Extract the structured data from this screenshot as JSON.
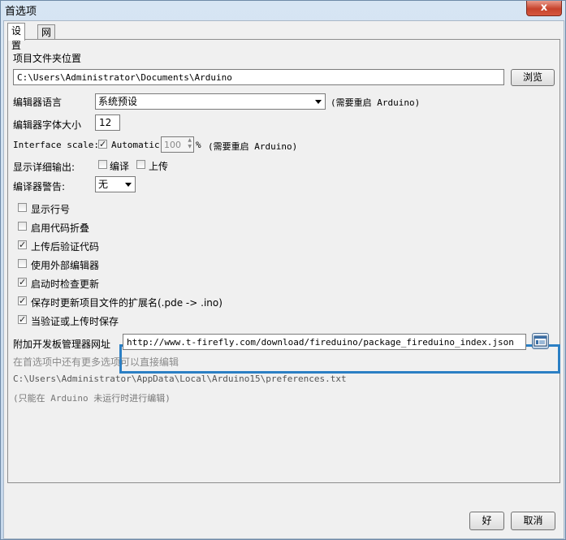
{
  "window": {
    "title": "首选项",
    "close_label": "x"
  },
  "tabs": [
    {
      "label": "设置"
    },
    {
      "label": "网络"
    }
  ],
  "sketchbook": {
    "label": "项目文件夹位置",
    "path": "C:\\Users\\Administrator\\Documents\\Arduino",
    "browse_label": "浏览"
  },
  "editor_language": {
    "label": "编辑器语言",
    "value": "系统预设",
    "note": "(需要重启 Arduino)"
  },
  "font_size": {
    "label": "编辑器字体大小",
    "value": "12"
  },
  "interface_scale": {
    "label": "Interface scale:",
    "automatic_label": "Automatic",
    "automatic_checked": true,
    "value": "100",
    "unit": "%",
    "note": "(需要重启 Arduino)"
  },
  "verbose": {
    "label": "显示详细输出:",
    "compile_label": "编译",
    "compile_checked": false,
    "upload_label": "上传",
    "upload_checked": false
  },
  "compiler_warnings": {
    "label": "编译器警告:",
    "value": "无"
  },
  "options": [
    {
      "label": "显示行号",
      "checked": false
    },
    {
      "label": "启用代码折叠",
      "checked": false
    },
    {
      "label": "上传后验证代码",
      "checked": true
    },
    {
      "label": "使用外部编辑器",
      "checked": false
    },
    {
      "label": "启动时检查更新",
      "checked": true
    },
    {
      "label": "保存时更新项目文件的扩展名(.pde -> .ino)",
      "checked": true
    },
    {
      "label": "当验证或上传时保存",
      "checked": true
    }
  ],
  "board_urls": {
    "label": "附加开发板管理器网址",
    "value": "http://www.t-firefly.com/download/fireduino/package_fireduino_index.json"
  },
  "more_prefs": {
    "text": "在首选项中还有更多选项可以直接编辑",
    "path": "C:\\Users\\Administrator\\AppData\\Local\\Arduino15\\preferences.txt",
    "note": "(只能在 Arduino 未运行时进行编辑)"
  },
  "footer": {
    "ok_label": "好",
    "cancel_label": "取消"
  }
}
